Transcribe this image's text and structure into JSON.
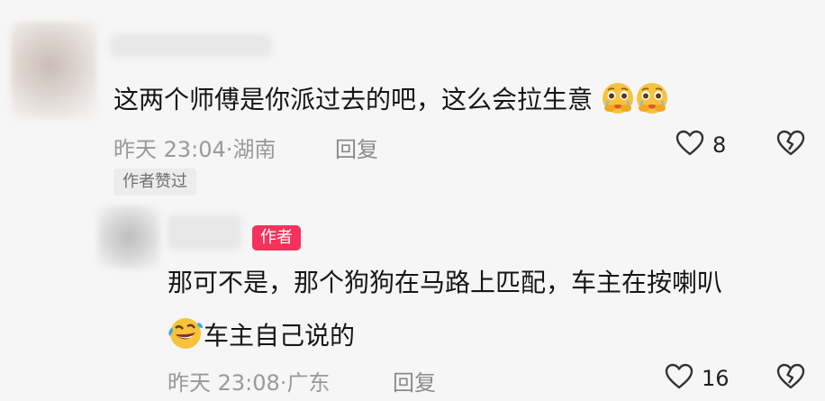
{
  "comment": {
    "text": "这两个师傅是你派过去的吧，这么会拉生意",
    "emojis": [
      "pleading-tears-emoji",
      "pleading-tears-emoji"
    ],
    "time": "昨天 23:04",
    "location": "湖南",
    "reply_label": "回复",
    "like_count": "8",
    "liked_by_author_tag": "作者赞过"
  },
  "reply": {
    "author_badge": "作者",
    "text_line1": "那可不是，那个狗狗在马路上匹配，车主在按喇叭",
    "text_line2": "车主自己说的",
    "emoji": "laughing-tears-emoji",
    "time": "昨天 23:08",
    "location": "广东",
    "reply_label": "回复",
    "like_count": "16"
  },
  "icons": {
    "like": "heart-outline-icon",
    "dislike": "broken-heart-icon"
  },
  "colors": {
    "background": "#f6f6f6",
    "author_badge": "#f5325c",
    "meta_text": "#9a9a9a",
    "emoji_yellow": "#f9c23c"
  }
}
